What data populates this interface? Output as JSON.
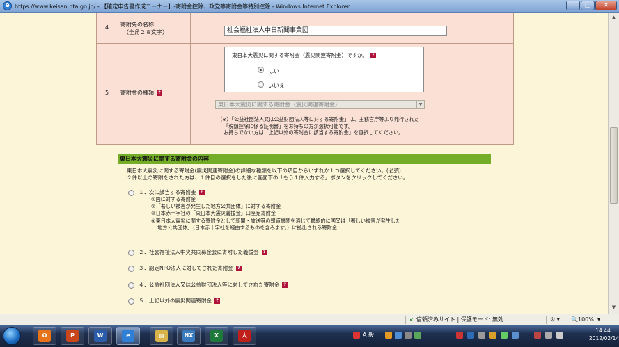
{
  "window": {
    "title": "https://www.keisan.nta.go.jp/ - 【確定申告書作成コーナー】-寄附金控除、政党等寄附金等特別控除 - Windows Internet Explorer",
    "icon": "ie-icon"
  },
  "row4": {
    "num": "4",
    "label_line1": "寄附先の名称",
    "label_line2": "（全角２８文字）",
    "input_value": "社会福祉法人中日新聞事業団"
  },
  "row5": {
    "num": "5",
    "label": "寄附金の種類",
    "question": "東日本大震災に関する寄附金（震災関連寄附金）ですか。",
    "yes": "はい",
    "no": "いいえ",
    "yes_selected": true,
    "select_value": "東日本大震災に関する寄附金（震災関連寄附金）",
    "note1": "（※）「公益社団法人又は公益財団法人等に対する寄附金」は、主務官庁等より発行された",
    "note2": "「税額控除に係る証明書」をお持ちの方が選択可能です。",
    "note3": "お持ちでない方は「上記以外の寄附金に該当する寄附金」を選択してください。"
  },
  "section": {
    "header": "東日本大震災に関する寄附金の内容",
    "intro1": "東日本大震災に関する寄附金(震災関連寄附金)の詳細な種類を以下の項目からいずれか１つ選択してください。(必須)",
    "intro2": "２件以上の寄附をされた方は、１件目の選択をした後に画面下の「もう１件入力する」ボタンをクリックしてください。",
    "options": [
      {
        "label": "１．次に該当する寄附金"
      },
      {
        "label": "２．社会福祉法人中央共同募金会に寄附した義援金"
      },
      {
        "label": "３．認定NPO法人に対してされた寄附金"
      },
      {
        "label": "４．公益社団法人又は公益財団法人等に対してされた寄附金"
      },
      {
        "label": "５．上記以外の震災関連寄附金"
      }
    ],
    "sub1": "①国に対する寄附金",
    "sub2": "②「著しい被害が発生した地方公共団体」に対する寄附金",
    "sub3": "③日本赤十字社の「東日本大震災義援金」口座宛寄附金",
    "sub4": "④東日本大震災に関する寄附金として新聞・放送等の報道機関を通じて最終的に国又は「著しい被害が発生した",
    "sub5": "地方公共団体」（日本赤十字社を経由するものを含みます。）に拠出される寄附金"
  },
  "status": {
    "zone": "信頼済みサイト | 保護モード: 無効",
    "zoom": "100%"
  },
  "taskbar": {
    "apps": [
      {
        "icon": "outlook-icon",
        "glyph": "O",
        "color": "#e8731a"
      },
      {
        "icon": "powerpoint-icon",
        "glyph": "P",
        "color": "#c9461b"
      },
      {
        "icon": "word-icon",
        "glyph": "W",
        "color": "#2a5caa"
      },
      {
        "icon": "ie-icon",
        "glyph": "e",
        "color": "#2f7fd6"
      },
      {
        "icon": "explorer-icon",
        "glyph": "▤",
        "color": "#d9b34a"
      },
      {
        "icon": "nx-icon",
        "glyph": "NX",
        "color": "#3a7bbf"
      },
      {
        "icon": "excel-icon",
        "glyph": "X",
        "color": "#1d7a3b"
      },
      {
        "icon": "acrobat-icon",
        "glyph": "人",
        "color": "#c0201a"
      }
    ],
    "ime": "A 般",
    "time": "14:44",
    "date": "2012/02/14"
  }
}
